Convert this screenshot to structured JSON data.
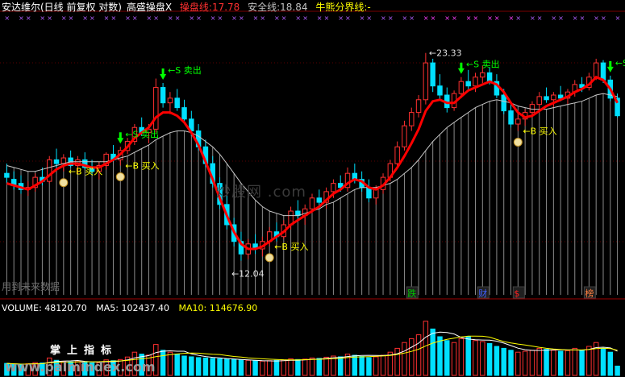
{
  "header": {
    "title": "安达维尔(日线 前复权 对数)",
    "indicator": "高盛操盘X",
    "operate_label": "操盘线:",
    "operate_value": "17.78",
    "safe_label": "安全线:",
    "safe_value": "18.84",
    "bullbear_label": "牛熊分界线:",
    "bullbear_value": "-"
  },
  "volume_header": {
    "volume_label": "VOLUME:",
    "volume_value": "48120.70",
    "ma5_label": "MA5:",
    "ma5_value": "102437.40",
    "ma10_label": "MA10:",
    "ma10_value": "114676.90"
  },
  "watermark": "炒股网 .com",
  "brand": "掌上指标",
  "site": "www.palmindex.com",
  "footnote": "用到未来数据",
  "colors": {
    "up": "#00e0ff",
    "down": "#00e0ff",
    "red_line": "#ff0000",
    "white_line": "#c8c8c8",
    "buy": "#ffff00",
    "sell": "#00ff00",
    "volume": "#ff3030",
    "ma5": "#ffffff",
    "ma10": "#ffff00"
  },
  "chart_data": [
    {
      "type": "candlestick",
      "title": "安达维尔(日线 前复权 对数)",
      "y_scale": "log",
      "ylim": [
        10.8,
        26.5
      ],
      "high_marker": "23.33",
      "low_marker": "12.04",
      "candles": [
        {
          "o": 15.9,
          "h": 16.4,
          "l": 15.4,
          "c": 15.7
        },
        {
          "o": 15.6,
          "h": 16.0,
          "l": 15.1,
          "c": 15.3
        },
        {
          "o": 15.4,
          "h": 15.8,
          "l": 14.9,
          "c": 15.1
        },
        {
          "o": 15.1,
          "h": 15.5,
          "l": 14.8,
          "c": 15.2
        },
        {
          "o": 15.2,
          "h": 15.9,
          "l": 15.0,
          "c": 15.7
        },
        {
          "o": 15.7,
          "h": 16.2,
          "l": 15.3,
          "c": 15.5
        },
        {
          "o": 15.5,
          "h": 16.8,
          "l": 15.4,
          "c": 16.6
        },
        {
          "o": 16.6,
          "h": 17.2,
          "l": 16.1,
          "c": 16.4
        },
        {
          "o": 16.4,
          "h": 16.9,
          "l": 16.0,
          "c": 16.7
        },
        {
          "o": 16.7,
          "h": 17.1,
          "l": 16.2,
          "c": 16.3
        },
        {
          "o": 16.3,
          "h": 16.8,
          "l": 15.9,
          "c": 16.6
        },
        {
          "o": 16.6,
          "h": 17.0,
          "l": 16.1,
          "c": 16.2
        },
        {
          "o": 16.2,
          "h": 16.6,
          "l": 15.8,
          "c": 16.0
        },
        {
          "o": 16.0,
          "h": 16.5,
          "l": 15.6,
          "c": 16.3
        },
        {
          "o": 16.3,
          "h": 17.0,
          "l": 16.1,
          "c": 16.9
        },
        {
          "o": 16.9,
          "h": 17.4,
          "l": 16.5,
          "c": 16.6
        },
        {
          "o": 16.6,
          "h": 17.3,
          "l": 16.3,
          "c": 17.1
        },
        {
          "o": 17.1,
          "h": 17.8,
          "l": 16.9,
          "c": 17.6
        },
        {
          "o": 17.6,
          "h": 18.6,
          "l": 17.4,
          "c": 18.4
        },
        {
          "o": 18.4,
          "h": 19.0,
          "l": 17.9,
          "c": 18.1
        },
        {
          "o": 18.1,
          "h": 18.6,
          "l": 17.5,
          "c": 18.3
        },
        {
          "o": 18.3,
          "h": 21.5,
          "l": 18.1,
          "c": 20.9
        },
        {
          "o": 20.9,
          "h": 21.2,
          "l": 19.6,
          "c": 19.9
        },
        {
          "o": 19.9,
          "h": 20.6,
          "l": 19.2,
          "c": 20.2
        },
        {
          "o": 20.2,
          "h": 20.8,
          "l": 19.4,
          "c": 19.6
        },
        {
          "o": 19.6,
          "h": 20.1,
          "l": 18.7,
          "c": 18.9
        },
        {
          "o": 18.9,
          "h": 19.4,
          "l": 17.9,
          "c": 18.2
        },
        {
          "o": 18.2,
          "h": 18.6,
          "l": 17.1,
          "c": 17.3
        },
        {
          "o": 17.3,
          "h": 17.7,
          "l": 16.2,
          "c": 16.4
        },
        {
          "o": 16.4,
          "h": 16.8,
          "l": 15.2,
          "c": 15.4
        },
        {
          "o": 15.4,
          "h": 15.7,
          "l": 14.2,
          "c": 14.4
        },
        {
          "o": 14.4,
          "h": 14.8,
          "l": 13.3,
          "c": 13.5
        },
        {
          "o": 13.5,
          "h": 13.8,
          "l": 12.6,
          "c": 12.8
        },
        {
          "o": 12.8,
          "h": 13.2,
          "l": 12.04,
          "c": 12.3
        },
        {
          "o": 12.3,
          "h": 12.9,
          "l": 12.1,
          "c": 12.7
        },
        {
          "o": 12.7,
          "h": 13.1,
          "l": 12.3,
          "c": 12.5
        },
        {
          "o": 12.5,
          "h": 13.0,
          "l": 12.2,
          "c": 12.8
        },
        {
          "o": 12.8,
          "h": 13.4,
          "l": 12.6,
          "c": 13.2
        },
        {
          "o": 13.2,
          "h": 13.6,
          "l": 12.8,
          "c": 13.0
        },
        {
          "o": 13.0,
          "h": 13.7,
          "l": 12.9,
          "c": 13.5
        },
        {
          "o": 13.5,
          "h": 14.3,
          "l": 13.3,
          "c": 14.1
        },
        {
          "o": 14.1,
          "h": 14.6,
          "l": 13.7,
          "c": 13.9
        },
        {
          "o": 13.9,
          "h": 14.4,
          "l": 13.5,
          "c": 14.2
        },
        {
          "o": 14.2,
          "h": 14.9,
          "l": 14.0,
          "c": 14.7
        },
        {
          "o": 14.7,
          "h": 15.1,
          "l": 14.3,
          "c": 14.5
        },
        {
          "o": 14.5,
          "h": 15.2,
          "l": 14.2,
          "c": 15.0
        },
        {
          "o": 15.0,
          "h": 15.6,
          "l": 14.7,
          "c": 15.4
        },
        {
          "o": 15.4,
          "h": 15.8,
          "l": 15.0,
          "c": 15.2
        },
        {
          "o": 15.2,
          "h": 16.2,
          "l": 15.0,
          "c": 15.9
        },
        {
          "o": 15.9,
          "h": 16.4,
          "l": 15.4,
          "c": 15.6
        },
        {
          "o": 15.6,
          "h": 16.0,
          "l": 15.0,
          "c": 15.2
        },
        {
          "o": 15.2,
          "h": 15.6,
          "l": 14.5,
          "c": 14.7
        },
        {
          "o": 14.7,
          "h": 15.3,
          "l": 14.4,
          "c": 15.1
        },
        {
          "o": 15.1,
          "h": 15.9,
          "l": 14.9,
          "c": 15.7
        },
        {
          "o": 15.7,
          "h": 16.6,
          "l": 15.5,
          "c": 16.4
        },
        {
          "o": 16.4,
          "h": 17.6,
          "l": 16.2,
          "c": 17.3
        },
        {
          "o": 17.3,
          "h": 18.8,
          "l": 17.1,
          "c": 18.5
        },
        {
          "o": 18.5,
          "h": 19.6,
          "l": 18.2,
          "c": 19.3
        },
        {
          "o": 19.3,
          "h": 20.4,
          "l": 19.0,
          "c": 20.1
        },
        {
          "o": 20.1,
          "h": 23.33,
          "l": 19.8,
          "c": 22.6
        },
        {
          "o": 22.6,
          "h": 22.9,
          "l": 20.6,
          "c": 21.0
        },
        {
          "o": 21.0,
          "h": 21.8,
          "l": 20.1,
          "c": 20.4
        },
        {
          "o": 20.4,
          "h": 20.9,
          "l": 19.3,
          "c": 19.6
        },
        {
          "o": 19.6,
          "h": 20.7,
          "l": 19.4,
          "c": 20.5
        },
        {
          "o": 20.5,
          "h": 21.6,
          "l": 20.2,
          "c": 21.3
        },
        {
          "o": 21.3,
          "h": 22.1,
          "l": 20.8,
          "c": 21.0
        },
        {
          "o": 21.0,
          "h": 21.9,
          "l": 20.6,
          "c": 21.6
        },
        {
          "o": 21.6,
          "h": 22.4,
          "l": 21.2,
          "c": 21.9
        },
        {
          "o": 21.9,
          "h": 22.3,
          "l": 21.1,
          "c": 21.3
        },
        {
          "o": 21.3,
          "h": 21.8,
          "l": 20.2,
          "c": 20.4
        },
        {
          "o": 20.4,
          "h": 20.8,
          "l": 19.2,
          "c": 19.4
        },
        {
          "o": 19.4,
          "h": 19.8,
          "l": 18.4,
          "c": 18.6
        },
        {
          "o": 18.6,
          "h": 19.2,
          "l": 18.2,
          "c": 18.9
        },
        {
          "o": 18.9,
          "h": 19.5,
          "l": 18.5,
          "c": 19.3
        },
        {
          "o": 19.3,
          "h": 20.0,
          "l": 19.0,
          "c": 19.8
        },
        {
          "o": 19.8,
          "h": 20.6,
          "l": 19.5,
          "c": 20.3
        },
        {
          "o": 20.3,
          "h": 20.9,
          "l": 19.9,
          "c": 20.1
        },
        {
          "o": 20.1,
          "h": 20.6,
          "l": 19.6,
          "c": 20.4
        },
        {
          "o": 20.4,
          "h": 21.0,
          "l": 20.0,
          "c": 20.2
        },
        {
          "o": 20.2,
          "h": 20.8,
          "l": 19.8,
          "c": 20.6
        },
        {
          "o": 20.6,
          "h": 21.4,
          "l": 20.3,
          "c": 21.1
        },
        {
          "o": 21.1,
          "h": 21.6,
          "l": 20.6,
          "c": 20.9
        },
        {
          "o": 20.9,
          "h": 21.9,
          "l": 20.7,
          "c": 21.6
        },
        {
          "o": 21.6,
          "h": 22.9,
          "l": 21.4,
          "c": 22.6
        },
        {
          "o": 22.6,
          "h": 22.8,
          "l": 21.2,
          "c": 21.4
        },
        {
          "o": 21.4,
          "h": 21.7,
          "l": 20.0,
          "c": 20.2
        },
        {
          "o": 20.2,
          "h": 20.5,
          "l": 19.0,
          "c": 19.1
        }
      ],
      "operate_line": [
        15.4,
        15.3,
        15.2,
        15.1,
        15.3,
        15.5,
        15.8,
        16.1,
        16.3,
        16.4,
        16.4,
        16.3,
        16.2,
        16.2,
        16.4,
        16.6,
        16.9,
        17.3,
        17.8,
        18.1,
        18.4,
        19.0,
        19.3,
        19.3,
        19.1,
        18.7,
        18.1,
        17.4,
        16.5,
        15.6,
        14.7,
        13.9,
        13.2,
        12.7,
        12.5,
        12.5,
        12.6,
        12.8,
        13.0,
        13.2,
        13.5,
        13.7,
        13.9,
        14.1,
        14.3,
        14.6,
        14.9,
        15.1,
        15.4,
        15.6,
        15.5,
        15.2,
        15.1,
        15.3,
        15.7,
        16.2,
        16.8,
        17.5,
        18.3,
        19.4,
        20.0,
        20.1,
        19.9,
        19.9,
        20.3,
        20.7,
        20.9,
        21.1,
        21.3,
        21.1,
        20.6,
        19.9,
        19.3,
        19.0,
        19.1,
        19.4,
        19.7,
        19.9,
        20.1,
        20.3,
        20.6,
        20.8,
        21.1,
        21.6,
        21.4,
        20.8,
        19.9
      ],
      "safe_line": [
        16.3,
        16.2,
        16.1,
        16.0,
        16.0,
        16.1,
        16.2,
        16.3,
        16.4,
        16.5,
        16.5,
        16.5,
        16.5,
        16.5,
        16.5,
        16.6,
        16.7,
        16.8,
        17.0,
        17.2,
        17.4,
        17.7,
        17.9,
        18.1,
        18.2,
        18.2,
        18.1,
        17.9,
        17.6,
        17.3,
        16.9,
        16.4,
        15.9,
        15.4,
        15.0,
        14.6,
        14.3,
        14.1,
        14.0,
        13.9,
        13.9,
        13.9,
        14.0,
        14.1,
        14.2,
        14.4,
        14.5,
        14.7,
        14.9,
        15.1,
        15.2,
        15.2,
        15.2,
        15.3,
        15.4,
        15.6,
        15.9,
        16.2,
        16.6,
        17.1,
        17.6,
        18.0,
        18.4,
        18.7,
        19.0,
        19.3,
        19.6,
        19.8,
        20.0,
        20.1,
        20.0,
        19.9,
        19.7,
        19.6,
        19.5,
        19.5,
        19.5,
        19.6,
        19.7,
        19.8,
        19.9,
        20.0,
        20.2,
        20.4,
        20.5,
        20.4,
        20.3
      ],
      "signals": [
        {
          "index": 8,
          "type": "buy",
          "label": "←B 买入"
        },
        {
          "index": 16,
          "type": "sell",
          "label": "←S 卖出"
        },
        {
          "index": 16,
          "type": "buy",
          "label": "←B 买入"
        },
        {
          "index": 22,
          "type": "sell",
          "label": "←S 卖出"
        },
        {
          "index": 37,
          "type": "buy",
          "label": "←B 买入"
        },
        {
          "index": 64,
          "type": "sell",
          "label": "←S 卖出"
        },
        {
          "index": 72,
          "type": "buy",
          "label": "←B 买入"
        },
        {
          "index": 85,
          "type": "sell",
          "label": "←S"
        }
      ],
      "event_tags": [
        {
          "index": 57,
          "label": "跌",
          "color": "#00c800"
        },
        {
          "index": 67,
          "label": "财",
          "color": "#4060ff"
        },
        {
          "index": 72,
          "label": "$",
          "color": "#ff2020"
        },
        {
          "index": 82,
          "label": "榜",
          "color": "#ff8040"
        }
      ]
    },
    {
      "type": "bar",
      "title": "VOLUME",
      "series": [
        {
          "name": "VOLUME",
          "values": [
            62000,
            58000,
            55000,
            60000,
            66000,
            64000,
            90000,
            78000,
            72000,
            70000,
            75000,
            68000,
            64000,
            66000,
            80000,
            76000,
            82000,
            95000,
            120000,
            110000,
            105000,
            160000,
            130000,
            120000,
            110000,
            100000,
            96000,
            92000,
            90000,
            88000,
            86000,
            84000,
            82000,
            80000,
            78000,
            76000,
            74000,
            76000,
            78000,
            80000,
            86000,
            82000,
            84000,
            90000,
            88000,
            94000,
            100000,
            96000,
            110000,
            104000,
            98000,
            92000,
            96000,
            104000,
            120000,
            140000,
            170000,
            190000,
            210000,
            280000,
            240000,
            200000,
            180000,
            170000,
            190000,
            200000,
            180000,
            175000,
            165000,
            150000,
            140000,
            130000,
            120000,
            125000,
            130000,
            140000,
            135000,
            130000,
            125000,
            128000,
            140000,
            130000,
            150000,
            170000,
            140000,
            120000,
            48120.7
          ]
        },
        {
          "name": "MA5",
          "values": [
            62000,
            60000,
            58333,
            58750,
            60200,
            60600,
            67000,
            71600,
            74000,
            74800,
            77000,
            72600,
            69800,
            68600,
            70600,
            70800,
            73600,
            79800,
            90600,
            96600,
            102400,
            118000,
            125000,
            127000,
            125000,
            125000,
            111200,
            103600,
            97600,
            93200,
            90400,
            87200,
            84800,
            82400,
            80000,
            78000,
            76000,
            74800,
            74400,
            76000,
            77800,
            78400,
            80400,
            82800,
            84000,
            87600,
            91200,
            92400,
            97600,
            101400,
            103400,
            103800,
            103200,
            102400,
            104800,
            112000,
            126000,
            146000,
            166800,
            198000,
            218000,
            224000,
            222000,
            214000,
            196000,
            188000,
            184000,
            183000,
            182000,
            177000,
            167000,
            154000,
            141000,
            133000,
            129000,
            129000,
            130000,
            132000,
            132000,
            131600,
            131600,
            130600,
            134600,
            143600,
            146000,
            142000,
            125624
          ]
        },
        {
          "name": "MA10",
          "values": [
            62000,
            60000,
            58333,
            58750,
            60200,
            60500,
            65000,
            67625,
            68111,
            68300,
            69600,
            70600,
            70500,
            71000,
            72400,
            73600,
            74800,
            77500,
            82300,
            86500,
            89500,
            96800,
            102000,
            107400,
            111000,
            114000,
            115400,
            115100,
            111900,
            109700,
            107800,
            102600,
            98000,
            94700,
            90600,
            88000,
            85800,
            83700,
            82200,
            80900,
            80400,
            80400,
            81200,
            82500,
            83500,
            84900,
            87000,
            88800,
            92000,
            94700,
            95900,
            96900,
            98900,
            100300,
            103500,
            108300,
            115500,
            124100,
            135400,
            152700,
            166900,
            177700,
            186100,
            192700,
            199300,
            203000,
            203000,
            202500,
            198000,
            186000,
            175000,
            168000,
            162000,
            157500,
            151500,
            145500,
            140000,
            136300,
            133800,
            131600,
            131700,
            131700,
            133700,
            138900,
            140900,
            138800,
            130170
          ]
        }
      ]
    }
  ]
}
